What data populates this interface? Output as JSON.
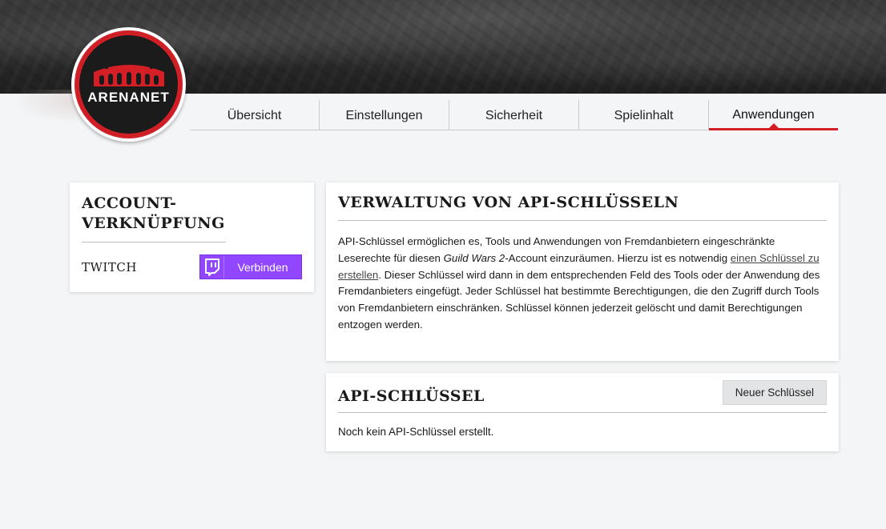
{
  "logo": {
    "text": "ARENANET"
  },
  "tabs": [
    {
      "label": "Übersicht",
      "active": false
    },
    {
      "label": "Einstellungen",
      "active": false
    },
    {
      "label": "Sicherheit",
      "active": false
    },
    {
      "label": "Spielinhalt",
      "active": false
    },
    {
      "label": "Anwendungen",
      "active": true
    }
  ],
  "account_link": {
    "title": "Account-Verknüpfung",
    "service_label": "TWITCH",
    "connect_button": "Verbinden"
  },
  "api_management": {
    "title": "Verwaltung von API-Schlüsseln",
    "text_1": "API-Schlüssel ermöglichen es, Tools und Anwendungen von Fremdanbietern eingeschränkte Leserechte für diesen ",
    "game_name": "Guild Wars 2",
    "text_2": "-Account einzuräumen. Hierzu ist es notwendig ",
    "link_text": "einen Schlüssel zu erstellen",
    "text_3": ". Dieser Schlüssel wird dann in dem entsprechenden Feld des Tools oder der Anwendung des Fremdanbieters eingefügt. Jeder Schlüssel hat bestimmte Berechtigungen, die den Zugriff durch Tools von Fremdanbietern einschränken. Schlüssel können jederzeit gelöscht und damit Berechtigungen entzogen werden."
  },
  "api_keys": {
    "title": "API-Schlüssel",
    "new_key_button": "Neuer Schlüssel",
    "empty_message": "Noch kein API-Schlüssel erstellt."
  },
  "colors": {
    "accent": "#d51f26",
    "twitch": "#9146ff",
    "background": "#f3f5f6"
  }
}
